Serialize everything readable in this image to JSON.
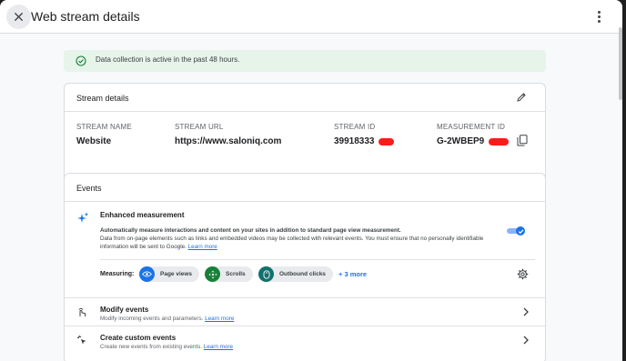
{
  "header": {
    "title": "Web stream details"
  },
  "banner": {
    "text": "Data collection is active in the past 48 hours."
  },
  "stream_details": {
    "title": "Stream details",
    "columns": [
      {
        "label": "STREAM NAME",
        "value": "Website"
      },
      {
        "label": "STREAM URL",
        "value": "https://www.saloniq.com"
      },
      {
        "label": "STREAM ID",
        "value": "39918333"
      },
      {
        "label": "MEASUREMENT ID",
        "value": "G-2WBEP9"
      }
    ]
  },
  "events": {
    "title": "Events",
    "enhanced": {
      "title": "Enhanced measurement",
      "desc_bold": "Automatically measure interactions and content on your sites in addition to standard page view measurement.",
      "desc": "Data from on-page elements such as links and embedded videos may be collected with relevant events. You must ensure that no personally identifiable information will be sent to Google.",
      "learn_more": "Learn more",
      "enabled": true
    },
    "measuring": {
      "label": "Measuring:",
      "chips": [
        "Page views",
        "Scrolls",
        "Outbound clicks"
      ],
      "more": "+ 3 more"
    },
    "rows": [
      {
        "title": "Modify events",
        "subtitle": "Modify incoming events and parameters.",
        "link": "Learn more"
      },
      {
        "title": "Create custom events",
        "subtitle": "Create new events from existing events.",
        "link": "Learn more"
      }
    ]
  },
  "colors": {
    "accent": "#1a73e8",
    "success": "#188038",
    "banner_bg": "#e6f4ea",
    "chip_pageviews": "#1a73e8",
    "chip_scrolls": "#188038",
    "chip_outbound": "#12706e"
  }
}
